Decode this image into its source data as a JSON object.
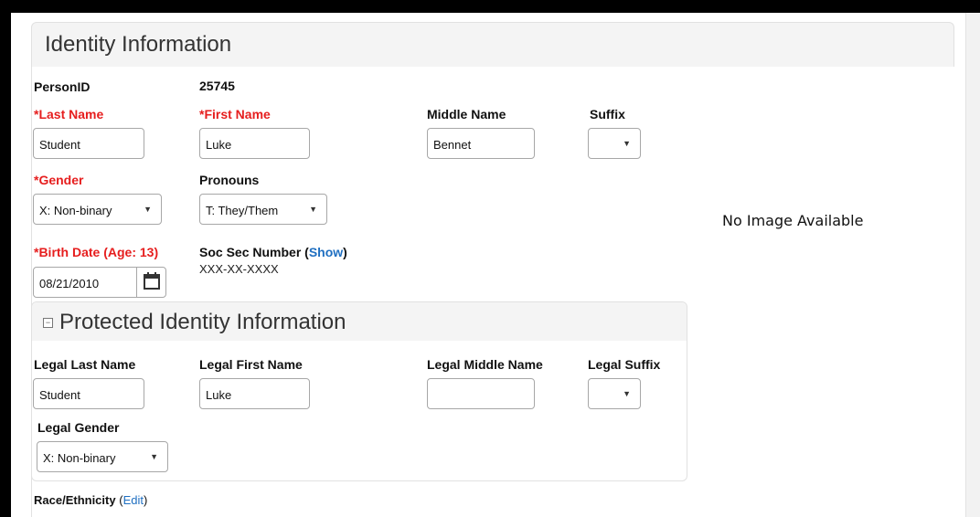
{
  "panel": {
    "title": "Identity Information"
  },
  "person": {
    "id_label": "PersonID",
    "id_value": "25745"
  },
  "fields": {
    "last_name": {
      "label": "*Last Name",
      "value": "Student"
    },
    "first_name": {
      "label": "*First Name",
      "value": "Luke"
    },
    "middle_name": {
      "label": "Middle Name",
      "value": "Bennet"
    },
    "suffix": {
      "label": "Suffix",
      "value": ""
    },
    "gender": {
      "label": "*Gender",
      "value": "X: Non-binary"
    },
    "pronouns": {
      "label": "Pronouns",
      "value": "T: They/Them"
    },
    "birth_date": {
      "label": "*Birth Date (Age: 13)",
      "value": "08/21/2010"
    },
    "ssn": {
      "label_prefix": "Soc Sec Number (",
      "link": "Show",
      "label_suffix": ")",
      "value": "XXX-XX-XXXX"
    }
  },
  "photo": {
    "text": "No Image Available"
  },
  "protected": {
    "title": "Protected Identity Information",
    "collapse_symbol": "−",
    "legal_last_name": {
      "label": "Legal Last Name",
      "value": "Student"
    },
    "legal_first_name": {
      "label": "Legal First Name",
      "value": "Luke"
    },
    "legal_middle_name": {
      "label": "Legal Middle Name",
      "value": ""
    },
    "legal_suffix": {
      "label": "Legal Suffix",
      "value": ""
    },
    "legal_gender": {
      "label": "Legal Gender",
      "value": "X: Non-binary"
    }
  },
  "race": {
    "label": "Race/Ethnicity",
    "link_prefix": "(",
    "link": "Edit",
    "link_suffix": ")"
  },
  "icons": {
    "dropdown": "▼",
    "calendar": "calendar-icon"
  }
}
